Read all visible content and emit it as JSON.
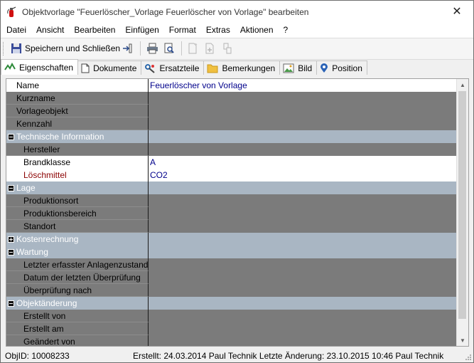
{
  "window": {
    "title": "Objektvorlage \"Feuerlöscher_Vorlage Feuerlöscher von Vorlage\" bearbeiten",
    "close_glyph": "✕"
  },
  "menu": [
    "Datei",
    "Ansicht",
    "Bearbeiten",
    "Einfügen",
    "Format",
    "Extras",
    "Aktionen",
    "?"
  ],
  "toolbar": {
    "save_close_label": "Speichern und Schließen",
    "icons": [
      "save-icon",
      "exit-icon",
      "print-icon",
      "print-preview-icon",
      "new-doc-icon",
      "add-doc-icon",
      "link-doc-icon"
    ]
  },
  "tabs": [
    {
      "label": "Eigenschaften",
      "icon": "properties-icon",
      "active": true
    },
    {
      "label": "Dokumente",
      "icon": "document-icon",
      "active": false
    },
    {
      "label": "Ersatzteile",
      "icon": "spare-parts-icon",
      "active": false
    },
    {
      "label": "Bemerkungen",
      "icon": "folder-icon",
      "active": false
    },
    {
      "label": "Bild",
      "icon": "image-icon",
      "active": false
    },
    {
      "label": "Position",
      "icon": "location-pin-icon",
      "active": false
    }
  ],
  "properties": [
    {
      "label": "Name",
      "value": "Feuerlöscher von Vorlage",
      "style": "white"
    },
    {
      "label": "Kurzname",
      "value": "",
      "style": "gray"
    },
    {
      "label": "Vorlageobjekt",
      "value": "",
      "style": "gray"
    },
    {
      "label": "Kennzahl",
      "value": "",
      "style": "gray"
    },
    {
      "label": "Technische Information",
      "value": "",
      "style": "head",
      "expanded": true
    },
    {
      "label": "Hersteller",
      "value": "",
      "style": "gray",
      "sub": true
    },
    {
      "label": "Brandklasse",
      "value": "A",
      "style": "white",
      "sub": true
    },
    {
      "label": "Löschmittel",
      "value": "CO2",
      "style": "white red",
      "sub": true
    },
    {
      "label": "Lage",
      "value": "",
      "style": "head",
      "expanded": true
    },
    {
      "label": "Produktionsort",
      "value": "",
      "style": "gray",
      "sub": true
    },
    {
      "label": "Produktionsbereich",
      "value": "",
      "style": "gray",
      "sub": true
    },
    {
      "label": "Standort",
      "value": "",
      "style": "gray",
      "sub": true
    },
    {
      "label": "Kostenrechnung",
      "value": "",
      "style": "head",
      "expanded": false
    },
    {
      "label": "Wartung",
      "value": "",
      "style": "head",
      "expanded": true
    },
    {
      "label": "Letzter erfasster Anlagenzustand",
      "value": "",
      "style": "gray",
      "sub": true
    },
    {
      "label": "Datum der letzten Überprüfung",
      "value": "",
      "style": "gray",
      "sub": true
    },
    {
      "label": "Überprüfung nach",
      "value": "",
      "style": "gray",
      "sub": true
    },
    {
      "label": "Objektänderung",
      "value": "",
      "style": "head",
      "expanded": true
    },
    {
      "label": "Erstellt von",
      "value": "",
      "style": "gray",
      "sub": true
    },
    {
      "label": "Erstellt am",
      "value": "",
      "style": "gray",
      "sub": true
    },
    {
      "label": "Geändert von",
      "value": "",
      "style": "gray",
      "sub": true
    }
  ],
  "status": {
    "obj_id": "ObjID: 10008233",
    "info": "Erstellt: 24.03.2014 Paul Technik  Letzte Änderung: 23.10.2015 10:46 Paul Technik"
  },
  "colors": {
    "row_gray": "#7b7b7b",
    "row_header": "#a9b6c3",
    "value_text": "#00008b",
    "required_label": "#8b0000"
  }
}
